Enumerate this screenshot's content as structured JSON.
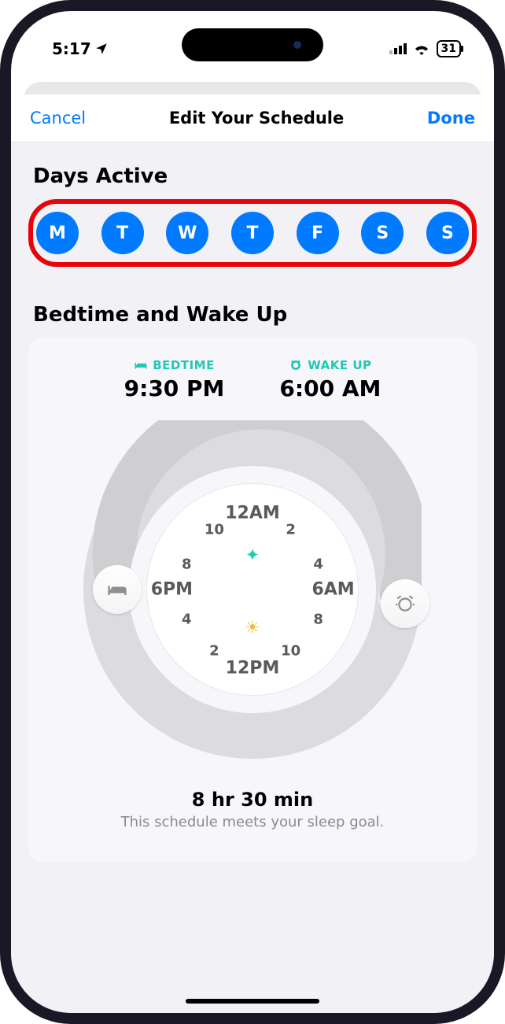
{
  "status": {
    "time": "5:17",
    "battery": "31"
  },
  "nav": {
    "cancel": "Cancel",
    "title": "Edit Your Schedule",
    "done": "Done"
  },
  "sections": {
    "days": "Days Active",
    "sleep": "Bedtime and Wake Up"
  },
  "days": [
    "M",
    "T",
    "W",
    "T",
    "F",
    "S",
    "S"
  ],
  "bedtime": {
    "label": "BEDTIME",
    "value": "9:30 PM"
  },
  "wake": {
    "label": "WAKE UP",
    "value": "6:00 AM"
  },
  "clock": {
    "top": "12AM",
    "bottom": "12PM",
    "left": "6PM",
    "right": "6AM",
    "n2": "2",
    "n4": "4",
    "n8": "8",
    "n10": "10"
  },
  "summary": {
    "duration": "8 hr 30 min",
    "goal": "This schedule meets your sleep goal."
  }
}
